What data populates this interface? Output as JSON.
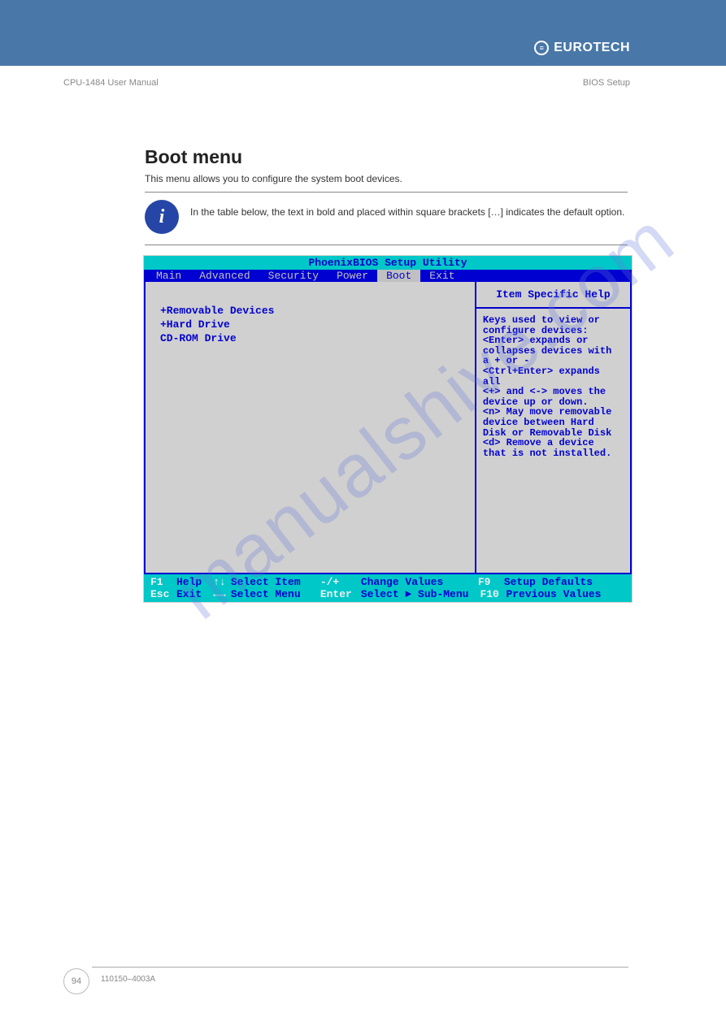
{
  "header": {
    "corner_mark": "",
    "brand": "EUROTECH"
  },
  "doc_meta": {
    "left": "CPU-1484 User Manual",
    "right": "BIOS Setup"
  },
  "section": {
    "heading": "Boot menu",
    "intro": "This menu allows you to configure the system boot devices.",
    "info_note": "In the table below, the text in bold and placed within square brackets […] indicates the default option."
  },
  "bios": {
    "title": "PhoenixBIOS Setup Utility",
    "menu": {
      "items": [
        "Main",
        "Advanced",
        "Security",
        "Power",
        "Boot",
        "Exit"
      ],
      "active_index": 4
    },
    "boot_list": [
      "+Removable Devices",
      "+Hard Drive",
      " CD-ROM Drive"
    ],
    "help_title": "Item Specific Help",
    "help_body": "Keys used to view or\nconfigure devices:\n<Enter> expands or\ncollapses devices with\na + or -\n<Ctrl+Enter> expands\nall\n<+> and <-> moves the\ndevice up or down.\n<n> May move removable\ndevice between Hard\nDisk or Removable Disk\n<d> Remove a device\nthat is not installed.",
    "footer": {
      "r1": {
        "k1": "F1",
        "t1": "Help",
        "s1": "↑↓",
        "t2": "Select Item",
        "s2": "-/+",
        "t3": "Change Values",
        "k2": "F9",
        "t4": "Setup Defaults"
      },
      "r2": {
        "k1": "Esc",
        "t1": "Exit",
        "s1": "←→",
        "t2": "Select Menu",
        "s2": "Enter",
        "t3": "Select ► Sub-Menu",
        "k2": "F10",
        "t4": "Previous Values"
      }
    }
  },
  "watermark": "manualshive.com",
  "footer": {
    "page": "94",
    "text": "110150–4003A"
  }
}
